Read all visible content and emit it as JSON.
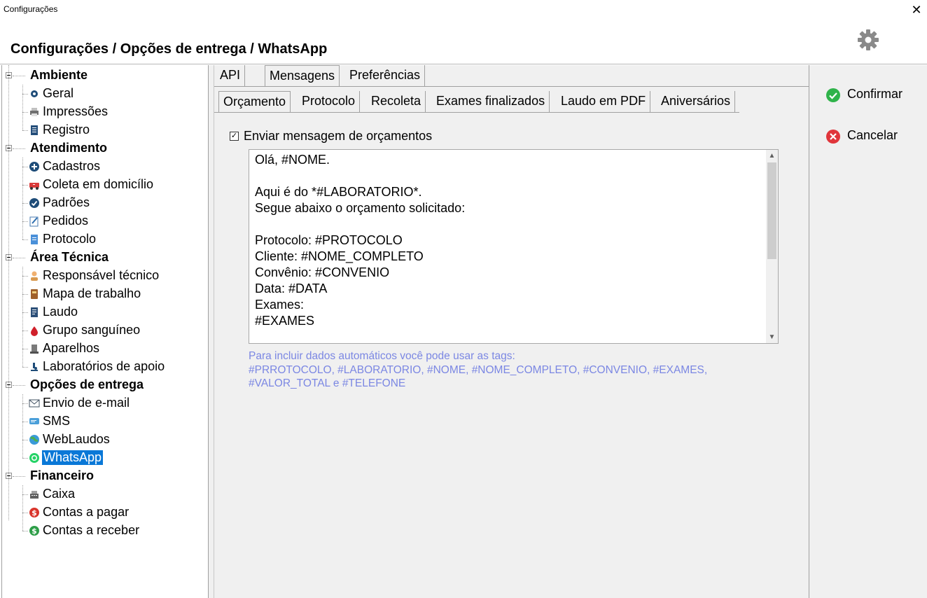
{
  "window": {
    "title": "Configurações",
    "close_glyph": "✕"
  },
  "header": {
    "title": "Configurações / Opções de entrega / WhatsApp",
    "icon": "gear-icon"
  },
  "tree": {
    "groups": [
      {
        "label": "Ambiente",
        "items": [
          {
            "label": "Geral",
            "icon": "gear-icon"
          },
          {
            "label": "Impressões",
            "icon": "printer-icon"
          },
          {
            "label": "Registro",
            "icon": "document-icon"
          }
        ]
      },
      {
        "label": "Atendimento",
        "items": [
          {
            "label": "Cadastros",
            "icon": "plus-circle-icon"
          },
          {
            "label": "Coleta em domicílio",
            "icon": "ambulance-icon"
          },
          {
            "label": "Padrões",
            "icon": "check-circle-icon"
          },
          {
            "label": "Pedidos",
            "icon": "edit-note-icon"
          },
          {
            "label": "Protocolo",
            "icon": "page-icon"
          }
        ]
      },
      {
        "label": "Área Técnica",
        "items": [
          {
            "label": "Responsável técnico",
            "icon": "person-icon"
          },
          {
            "label": "Mapa de trabalho",
            "icon": "book-icon"
          },
          {
            "label": "Laudo",
            "icon": "report-icon"
          },
          {
            "label": "Grupo sanguíneo",
            "icon": "blood-drop-icon"
          },
          {
            "label": "Aparelhos",
            "icon": "device-icon"
          },
          {
            "label": "Laboratórios de apoio",
            "icon": "microscope-icon"
          }
        ]
      },
      {
        "label": "Opções de entrega",
        "items": [
          {
            "label": "Envio de e-mail",
            "icon": "envelope-icon"
          },
          {
            "label": "SMS",
            "icon": "sms-icon"
          },
          {
            "label": "WebLaudos",
            "icon": "globe-icon"
          },
          {
            "label": "WhatsApp",
            "icon": "whatsapp-icon",
            "selected": true
          }
        ]
      },
      {
        "label": "Financeiro",
        "items": [
          {
            "label": "Caixa",
            "icon": "cash-register-icon"
          },
          {
            "label": "Contas a pagar",
            "icon": "dollar-red-icon"
          },
          {
            "label": "Contas a receber",
            "icon": "dollar-green-icon"
          }
        ]
      }
    ]
  },
  "tabs_main": [
    {
      "label": "API",
      "active": false
    },
    {
      "label": "Mensagens",
      "active": true
    },
    {
      "label": "Preferências",
      "active": false
    }
  ],
  "tabs_sub": [
    {
      "label": "Orçamento",
      "active": true
    },
    {
      "label": "Protocolo",
      "active": false
    },
    {
      "label": "Recoleta",
      "active": false
    },
    {
      "label": "Exames finalizados",
      "active": false
    },
    {
      "label": "Laudo em PDF",
      "active": false
    },
    {
      "label": "Aniversários",
      "active": false
    }
  ],
  "checkbox": {
    "label": "Enviar mensagem de orçamentos",
    "checked": true,
    "glyph": "✓"
  },
  "message": {
    "text": "Olá, #NOME.\n\nAqui é do *#LABORATORIO*.\nSegue abaixo o orçamento solicitado:\n\nProtocolo: #PROTOCOLO\nCliente: #NOME_COMPLETO\nConvênio: #CONVENIO\nData: #DATA\nExames:\n#EXAMES"
  },
  "hint": {
    "line1": "Para incluir dados automáticos você pode usar as tags:",
    "line2": "#PRROTOCOLO, #LABORATORIO, #NOME, #NOME_COMPLETO, #CONVENIO, #EXAMES,",
    "line3": "#VALOR_TOTAL e #TELEFONE"
  },
  "actions": {
    "confirm": {
      "label": "Confirmar",
      "icon": "check-circle-green-icon",
      "color": "#2fb34a"
    },
    "cancel": {
      "label": "Cancelar",
      "icon": "x-circle-red-icon",
      "color": "#e0353b"
    }
  },
  "colors": {
    "selection": "#0a78d7",
    "hint": "#7b87e3",
    "panel": "#f0f0f0"
  }
}
